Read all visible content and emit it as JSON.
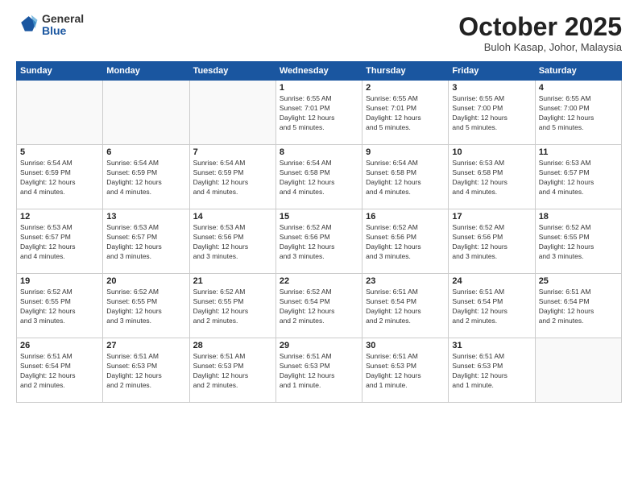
{
  "logo": {
    "general": "General",
    "blue": "Blue"
  },
  "title": "October 2025",
  "subtitle": "Buloh Kasap, Johor, Malaysia",
  "weekdays": [
    "Sunday",
    "Monday",
    "Tuesday",
    "Wednesday",
    "Thursday",
    "Friday",
    "Saturday"
  ],
  "weeks": [
    [
      {
        "day": "",
        "info": ""
      },
      {
        "day": "",
        "info": ""
      },
      {
        "day": "",
        "info": ""
      },
      {
        "day": "1",
        "info": "Sunrise: 6:55 AM\nSunset: 7:01 PM\nDaylight: 12 hours\nand 5 minutes."
      },
      {
        "day": "2",
        "info": "Sunrise: 6:55 AM\nSunset: 7:01 PM\nDaylight: 12 hours\nand 5 minutes."
      },
      {
        "day": "3",
        "info": "Sunrise: 6:55 AM\nSunset: 7:00 PM\nDaylight: 12 hours\nand 5 minutes."
      },
      {
        "day": "4",
        "info": "Sunrise: 6:55 AM\nSunset: 7:00 PM\nDaylight: 12 hours\nand 5 minutes."
      }
    ],
    [
      {
        "day": "5",
        "info": "Sunrise: 6:54 AM\nSunset: 6:59 PM\nDaylight: 12 hours\nand 4 minutes."
      },
      {
        "day": "6",
        "info": "Sunrise: 6:54 AM\nSunset: 6:59 PM\nDaylight: 12 hours\nand 4 minutes."
      },
      {
        "day": "7",
        "info": "Sunrise: 6:54 AM\nSunset: 6:59 PM\nDaylight: 12 hours\nand 4 minutes."
      },
      {
        "day": "8",
        "info": "Sunrise: 6:54 AM\nSunset: 6:58 PM\nDaylight: 12 hours\nand 4 minutes."
      },
      {
        "day": "9",
        "info": "Sunrise: 6:54 AM\nSunset: 6:58 PM\nDaylight: 12 hours\nand 4 minutes."
      },
      {
        "day": "10",
        "info": "Sunrise: 6:53 AM\nSunset: 6:58 PM\nDaylight: 12 hours\nand 4 minutes."
      },
      {
        "day": "11",
        "info": "Sunrise: 6:53 AM\nSunset: 6:57 PM\nDaylight: 12 hours\nand 4 minutes."
      }
    ],
    [
      {
        "day": "12",
        "info": "Sunrise: 6:53 AM\nSunset: 6:57 PM\nDaylight: 12 hours\nand 4 minutes."
      },
      {
        "day": "13",
        "info": "Sunrise: 6:53 AM\nSunset: 6:57 PM\nDaylight: 12 hours\nand 3 minutes."
      },
      {
        "day": "14",
        "info": "Sunrise: 6:53 AM\nSunset: 6:56 PM\nDaylight: 12 hours\nand 3 minutes."
      },
      {
        "day": "15",
        "info": "Sunrise: 6:52 AM\nSunset: 6:56 PM\nDaylight: 12 hours\nand 3 minutes."
      },
      {
        "day": "16",
        "info": "Sunrise: 6:52 AM\nSunset: 6:56 PM\nDaylight: 12 hours\nand 3 minutes."
      },
      {
        "day": "17",
        "info": "Sunrise: 6:52 AM\nSunset: 6:56 PM\nDaylight: 12 hours\nand 3 minutes."
      },
      {
        "day": "18",
        "info": "Sunrise: 6:52 AM\nSunset: 6:55 PM\nDaylight: 12 hours\nand 3 minutes."
      }
    ],
    [
      {
        "day": "19",
        "info": "Sunrise: 6:52 AM\nSunset: 6:55 PM\nDaylight: 12 hours\nand 3 minutes."
      },
      {
        "day": "20",
        "info": "Sunrise: 6:52 AM\nSunset: 6:55 PM\nDaylight: 12 hours\nand 3 minutes."
      },
      {
        "day": "21",
        "info": "Sunrise: 6:52 AM\nSunset: 6:55 PM\nDaylight: 12 hours\nand 2 minutes."
      },
      {
        "day": "22",
        "info": "Sunrise: 6:52 AM\nSunset: 6:54 PM\nDaylight: 12 hours\nand 2 minutes."
      },
      {
        "day": "23",
        "info": "Sunrise: 6:51 AM\nSunset: 6:54 PM\nDaylight: 12 hours\nand 2 minutes."
      },
      {
        "day": "24",
        "info": "Sunrise: 6:51 AM\nSunset: 6:54 PM\nDaylight: 12 hours\nand 2 minutes."
      },
      {
        "day": "25",
        "info": "Sunrise: 6:51 AM\nSunset: 6:54 PM\nDaylight: 12 hours\nand 2 minutes."
      }
    ],
    [
      {
        "day": "26",
        "info": "Sunrise: 6:51 AM\nSunset: 6:54 PM\nDaylight: 12 hours\nand 2 minutes."
      },
      {
        "day": "27",
        "info": "Sunrise: 6:51 AM\nSunset: 6:53 PM\nDaylight: 12 hours\nand 2 minutes."
      },
      {
        "day": "28",
        "info": "Sunrise: 6:51 AM\nSunset: 6:53 PM\nDaylight: 12 hours\nand 2 minutes."
      },
      {
        "day": "29",
        "info": "Sunrise: 6:51 AM\nSunset: 6:53 PM\nDaylight: 12 hours\nand 1 minute."
      },
      {
        "day": "30",
        "info": "Sunrise: 6:51 AM\nSunset: 6:53 PM\nDaylight: 12 hours\nand 1 minute."
      },
      {
        "day": "31",
        "info": "Sunrise: 6:51 AM\nSunset: 6:53 PM\nDaylight: 12 hours\nand 1 minute."
      },
      {
        "day": "",
        "info": ""
      }
    ]
  ]
}
